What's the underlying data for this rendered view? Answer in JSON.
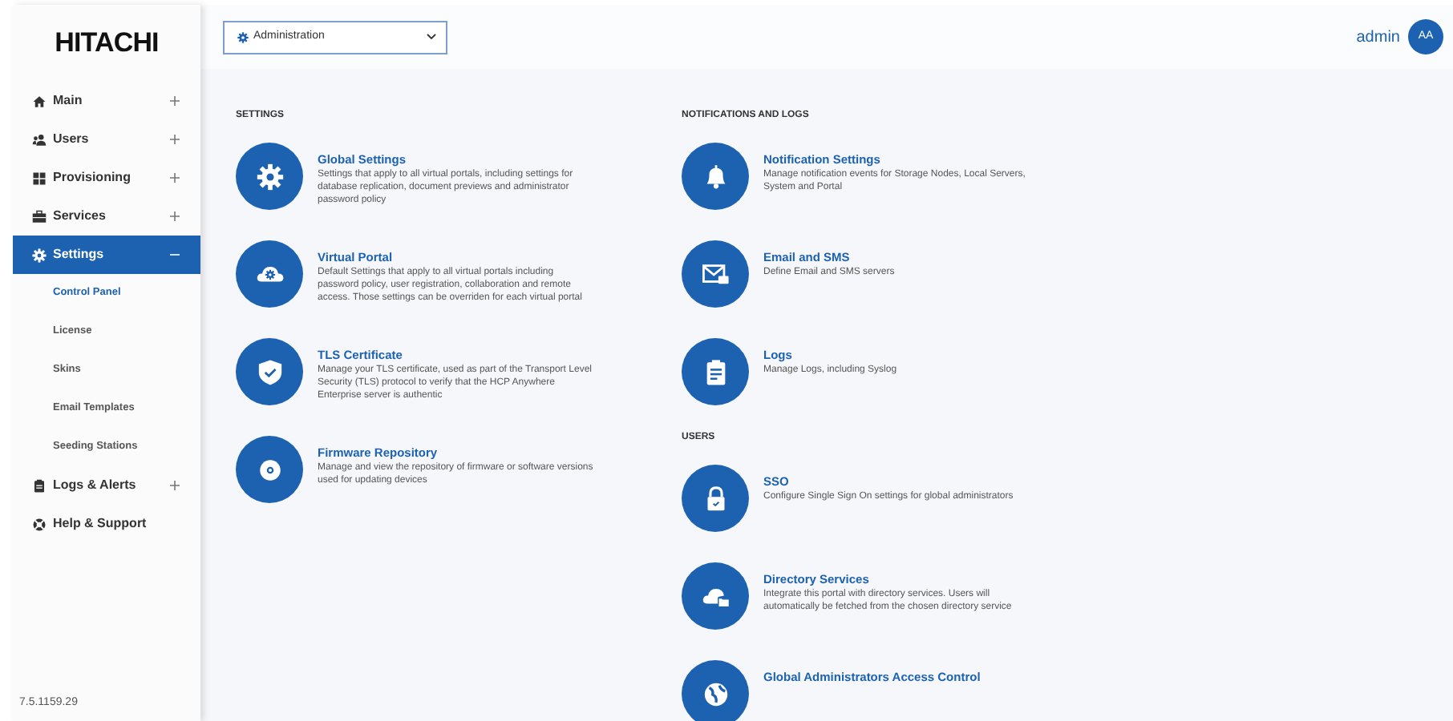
{
  "sidebar": {
    "logo": "HITACHI",
    "items": [
      {
        "label": "Main",
        "expanded": false,
        "selected": false
      },
      {
        "label": "Users",
        "expanded": false,
        "selected": false
      },
      {
        "label": "Provisioning",
        "expanded": false,
        "selected": false
      },
      {
        "label": "Services",
        "expanded": false,
        "selected": false
      },
      {
        "label": "Settings",
        "expanded": true,
        "selected": true,
        "children": [
          {
            "label": "Control Panel",
            "selected": true
          },
          {
            "label": "License",
            "selected": false
          },
          {
            "label": "Skins",
            "selected": false
          },
          {
            "label": "Email Templates",
            "selected": false
          },
          {
            "label": "Seeding Stations",
            "selected": false
          }
        ]
      },
      {
        "label": "Logs & Alerts",
        "expanded": false,
        "selected": false
      },
      {
        "label": "Help & Support",
        "selected": false
      }
    ],
    "version": "7.5.1159.29"
  },
  "header": {
    "context_select": "Administration",
    "user": "admin",
    "avatar": "AA"
  },
  "columns": [
    {
      "sections": [
        {
          "heading": "SETTINGS",
          "items": [
            {
              "title": "Global Settings",
              "description": "Settings that apply to all virtual portals, including settings for database replication, document previews and administrator password policy"
            },
            {
              "title": "Virtual Portal",
              "description": "Default Settings that apply to all virtual portals including password policy, user registration, collaboration and remote access. Those settings can be overriden for each virtual portal"
            },
            {
              "title": "TLS Certificate",
              "description": "Manage your TLS certificate, used as part of the Transport Level Security (TLS) protocol to verify that the HCP Anywhere Enterprise server is authentic"
            },
            {
              "title": "Firmware Repository",
              "description": "Manage and view the repository of firmware or software versions used for updating devices"
            }
          ]
        }
      ]
    },
    {
      "sections": [
        {
          "heading": "NOTIFICATIONS AND LOGS",
          "items": [
            {
              "title": "Notification Settings",
              "description": "Manage notification events for Storage Nodes, Local Servers, System and Portal"
            },
            {
              "title": "Email and SMS",
              "description": "Define Email and SMS servers"
            },
            {
              "title": "Logs",
              "description": "Manage Logs, including Syslog"
            }
          ]
        },
        {
          "heading": "USERS",
          "items": [
            {
              "title": "SSO",
              "description": "Configure Single Sign On settings for global administrators"
            },
            {
              "title": "Directory Services",
              "description": "Integrate this portal with directory services. Users will automatically be fetched from the chosen directory service"
            },
            {
              "title": "Global Administrators Access Control"
            }
          ]
        }
      ]
    }
  ]
}
